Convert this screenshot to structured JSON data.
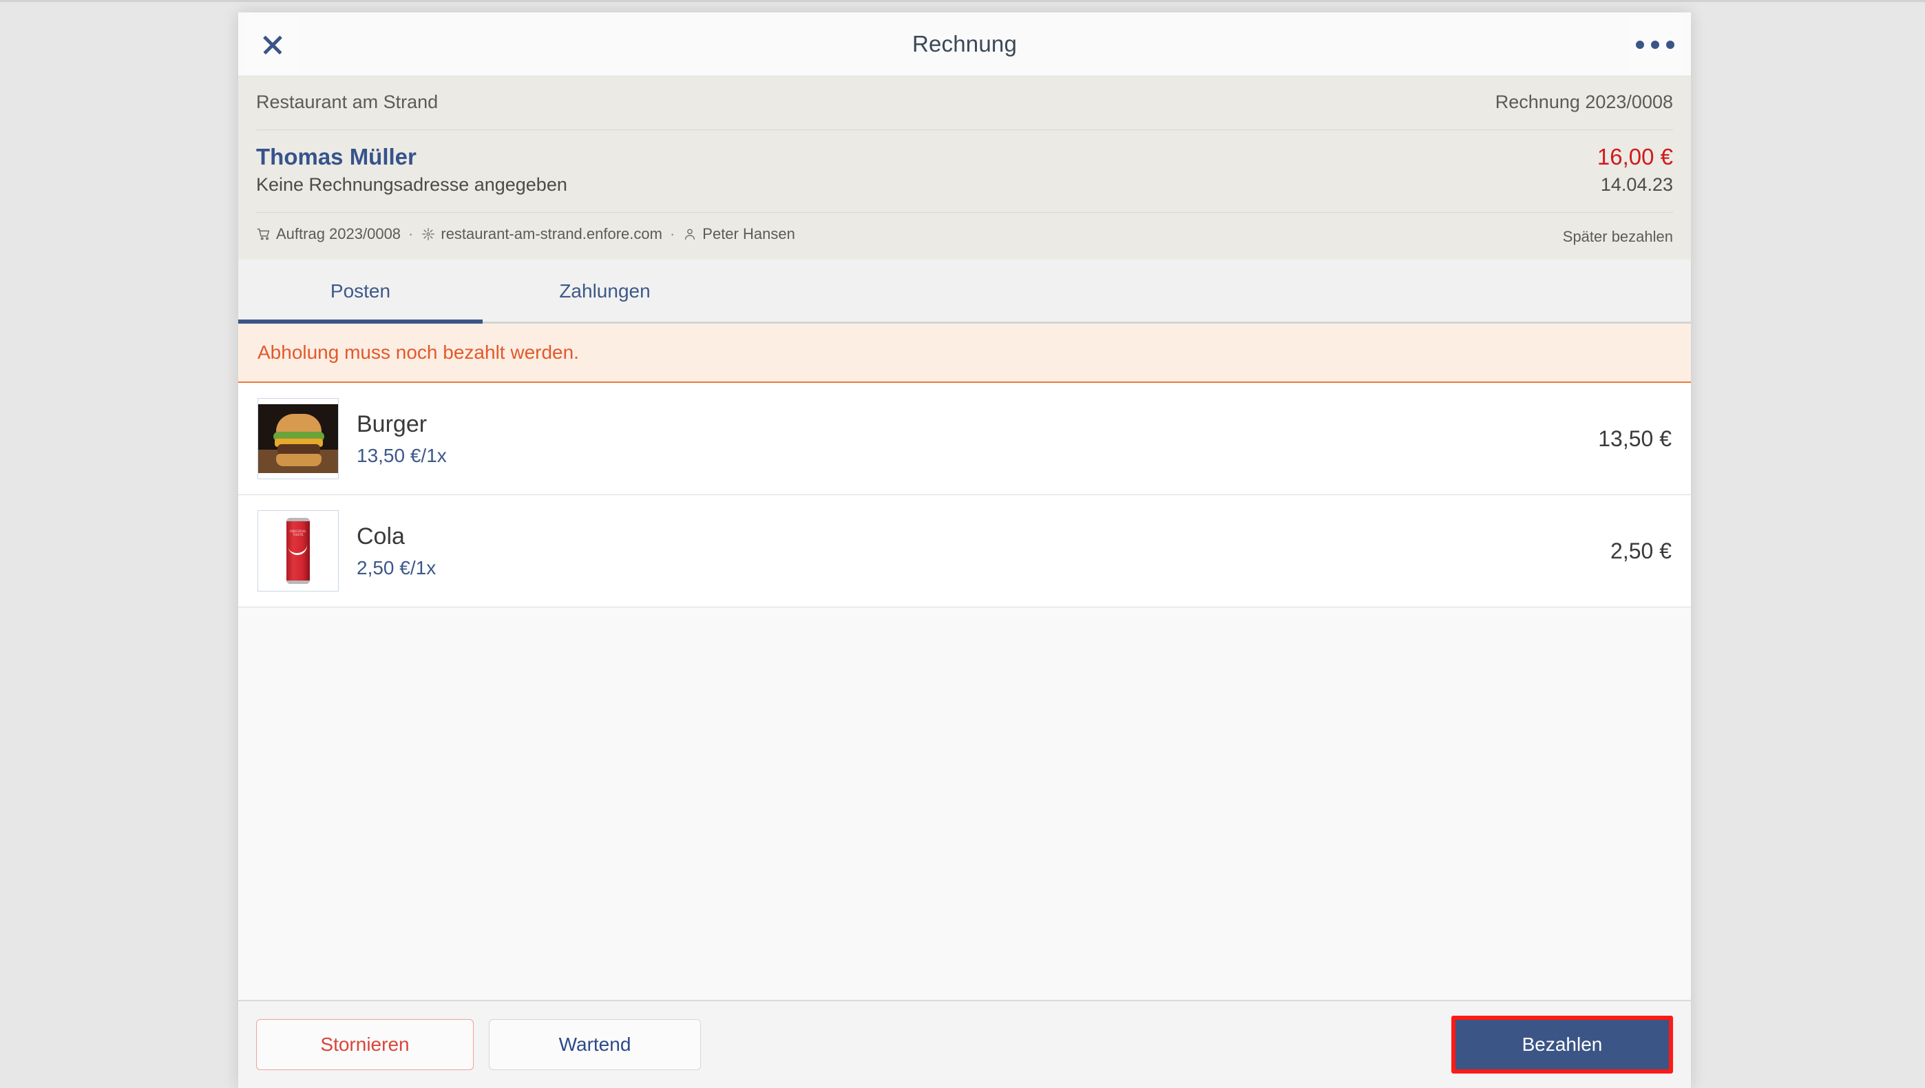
{
  "colors": {
    "accent_blue": "#3b5586",
    "danger_red": "#d01a1a",
    "warning_orange": "#e2592b",
    "highlight_red": "#ff1a14",
    "page_background": "#e7e7e7",
    "info_background": "#ebeae5"
  },
  "titlebar": {
    "title": "Rechnung",
    "close_icon": "close-icon",
    "more_icon": "more-options-icon"
  },
  "invoice": {
    "shop_name": "Restaurant am Strand",
    "invoice_number": "Rechnung 2023/0008",
    "customer_name": "Thomas Müller",
    "customer_address": "Keine Rechnungsadresse angegeben",
    "total_amount": "16,00 €",
    "date": "14.04.23",
    "payment_status": "Später bezahlen",
    "meta": {
      "order_icon": "shopping-cart-icon",
      "order": "Auftrag 2023/0008",
      "separator": "·",
      "domain_icon": "network-node-icon",
      "domain": "restaurant-am-strand.enfore.com",
      "user_icon": "person-icon",
      "user": "Peter Hansen"
    }
  },
  "tabs": [
    {
      "label": "Posten",
      "active": true
    },
    {
      "label": "Zahlungen",
      "active": false
    }
  ],
  "banner": {
    "message": "Abholung muss noch bezahlt werden."
  },
  "line_items": [
    {
      "name": "Burger",
      "unit_info": "13,50 €/1x",
      "price": "13,50 €",
      "thumbnail": "burger-photo"
    },
    {
      "name": "Cola",
      "unit_info": "2,50 €/1x",
      "price": "2,50 €",
      "thumbnail": "cola-can-photo"
    }
  ],
  "footer": {
    "cancel_label": "Stornieren",
    "waiting_label": "Wartend",
    "pay_label": "Bezahlen"
  }
}
